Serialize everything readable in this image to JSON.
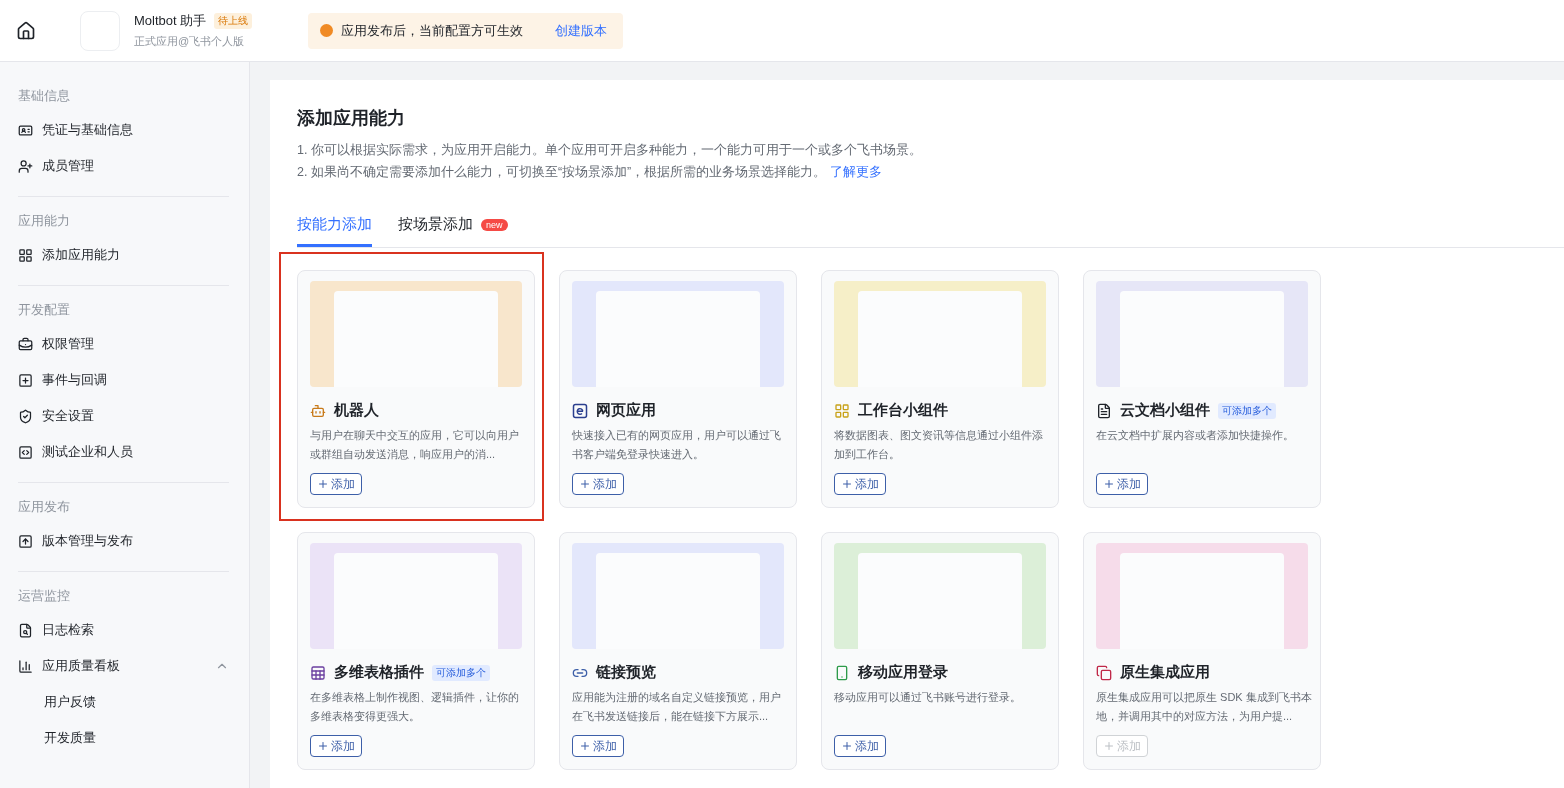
{
  "header": {
    "app_name": "Moltbot 助手",
    "status_badge": "待上线",
    "subtitle": "正式应用@飞书个人版",
    "notice": {
      "text": "应用发布后，当前配置方可生效",
      "link": "创建版本"
    }
  },
  "sidebar": {
    "sections": [
      {
        "label": "基础信息",
        "items": [
          {
            "label": "凭证与基础信息"
          },
          {
            "label": "成员管理"
          }
        ]
      },
      {
        "label": "应用能力",
        "items": [
          {
            "label": "添加应用能力"
          }
        ]
      },
      {
        "label": "开发配置",
        "items": [
          {
            "label": "权限管理"
          },
          {
            "label": "事件与回调"
          },
          {
            "label": "安全设置"
          },
          {
            "label": "测试企业和人员"
          }
        ]
      },
      {
        "label": "应用发布",
        "items": [
          {
            "label": "版本管理与发布"
          }
        ]
      },
      {
        "label": "运营监控",
        "items": [
          {
            "label": "日志检索"
          },
          {
            "label": "应用质量看板",
            "expanded": true,
            "children": [
              {
                "label": "用户反馈"
              },
              {
                "label": "开发质量"
              }
            ]
          }
        ]
      }
    ]
  },
  "page": {
    "title": "添加应用能力",
    "notes": [
      "1. 你可以根据实际需求，为应用开启能力。单个应用可开启多种能力，一个能力可用于一个或多个飞书场景。",
      "2. 如果尚不确定需要添加什么能力，可切换至“按场景添加”，根据所需的业务场景选择能力。"
    ],
    "notes_link": "了解更多",
    "tabs": [
      {
        "label": "按能力添加",
        "selected": true
      },
      {
        "label": "按场景添加",
        "selected": false,
        "badge": "new"
      }
    ],
    "cards": [
      {
        "title": "机器人",
        "description": "与用户在聊天中交互的应用，它可以向用户或群组自动发送消息，响应用户的消...",
        "button": "添加",
        "disabled": false,
        "highlighted": true
      },
      {
        "title": "网页应用",
        "description": "快速接入已有的网页应用，用户可以通过飞书客户端免登录快速进入。",
        "button": "添加",
        "disabled": false,
        "highlighted": false
      },
      {
        "title": "工作台小组件",
        "description": "将数据图表、图文资讯等信息通过小组件添加到工作台。",
        "button": "添加",
        "disabled": false,
        "highlighted": false
      },
      {
        "title": "云文档小组件",
        "badge": "可添加多个",
        "description": "在云文档中扩展内容或者添加快捷操作。",
        "button": "添加",
        "disabled": false,
        "highlighted": false
      },
      {
        "title": "多维表格插件",
        "badge": "可添加多个",
        "description": "在多维表格上制作视图、逻辑插件，让你的多维表格变得更强大。",
        "button": "添加",
        "disabled": false,
        "highlighted": false
      },
      {
        "title": "链接预览",
        "description": "应用能为注册的域名自定义链接预览，用户在飞书发送链接后，能在链接下方展示...",
        "button": "添加",
        "disabled": false,
        "highlighted": false
      },
      {
        "title": "移动应用登录",
        "description": "移动应用可以通过飞书账号进行登录。",
        "button": "添加",
        "disabled": false,
        "highlighted": false
      },
      {
        "title": "原生集成应用",
        "description": "原生集成应用可以把原生 SDK 集成到飞书本地，并调用其中的对应方法，为用户提...",
        "button": "添加",
        "disabled": true,
        "highlighted": false
      }
    ]
  }
}
